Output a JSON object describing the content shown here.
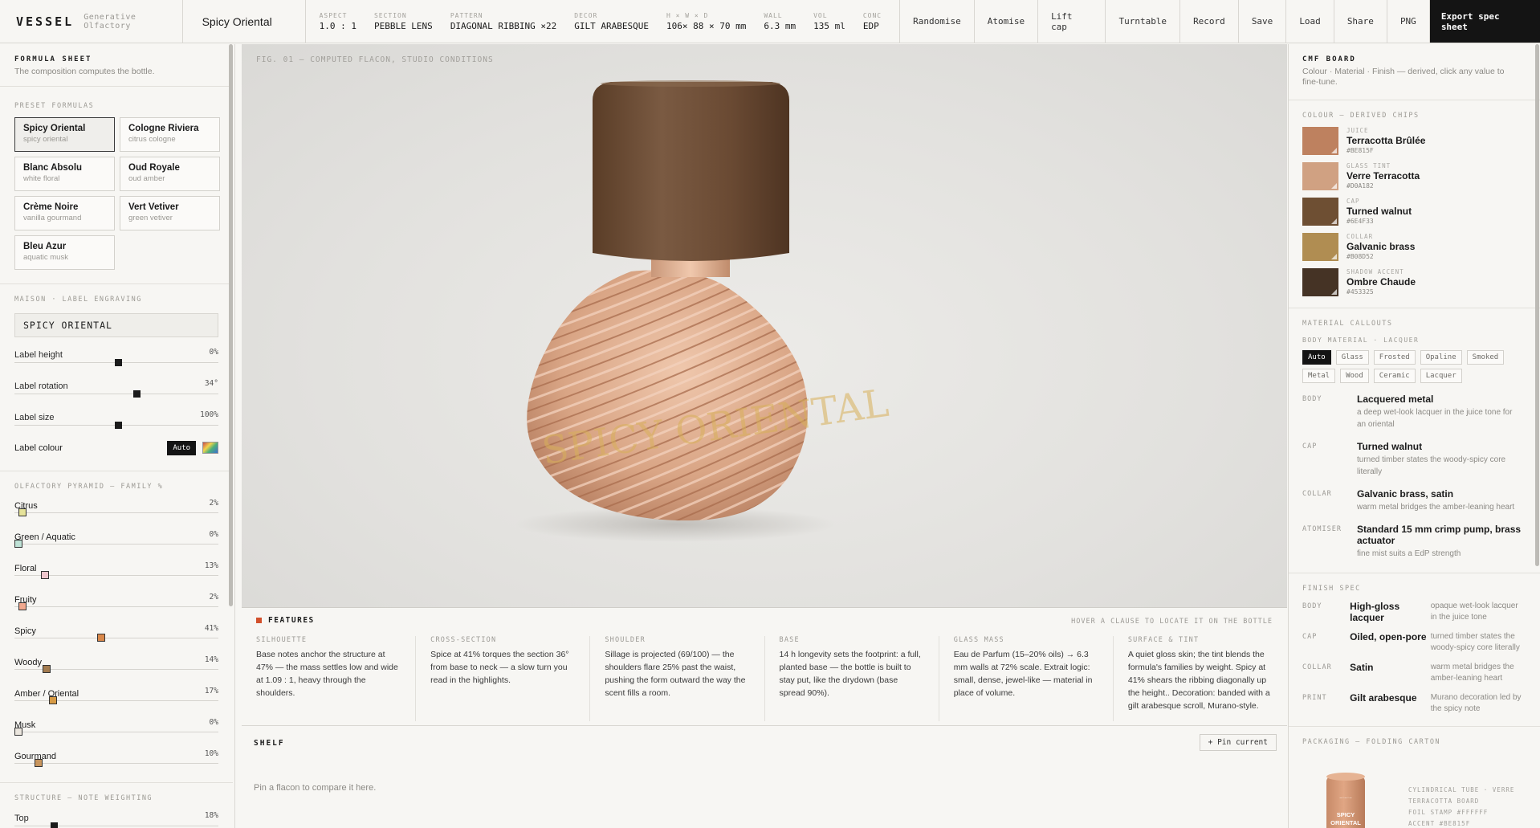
{
  "brand": {
    "logo": "VESSEL",
    "tagline": "Generative Olfactory"
  },
  "formula_name": "Spicy Oriental",
  "specs": [
    {
      "k": "ASPECT",
      "v": "1.0 : 1"
    },
    {
      "k": "SECTION",
      "v": "PEBBLE LENS"
    },
    {
      "k": "PATTERN",
      "v": "DIAGONAL RIBBING ×22"
    },
    {
      "k": "DECOR",
      "v": "GILT ARABESQUE"
    },
    {
      "k": "H × W × D",
      "v": "106× 88 × 70  mm"
    },
    {
      "k": "WALL",
      "v": "6.3  mm"
    },
    {
      "k": "VOL",
      "v": "135 ml"
    },
    {
      "k": "CONC",
      "v": "EDP"
    }
  ],
  "toolbar": {
    "randomise": "Randomise",
    "atomise": "Atomise",
    "lift_cap": "Lift cap",
    "turntable": "Turntable",
    "record": "Record",
    "save": "Save",
    "load": "Load",
    "share": "Share",
    "png": "PNG",
    "export": "Export spec sheet"
  },
  "left": {
    "title": "FORMULA SHEET",
    "subtitle": "The composition computes the bottle.",
    "presets_label": "PRESET FORMULAS",
    "presets": [
      {
        "name": "Spicy Oriental",
        "sub": "spicy oriental",
        "active": true
      },
      {
        "name": "Cologne Riviera",
        "sub": "citrus cologne"
      },
      {
        "name": "Blanc Absolu",
        "sub": "white floral"
      },
      {
        "name": "Oud Royale",
        "sub": "oud amber"
      },
      {
        "name": "Crème Noire",
        "sub": "vanilla gourmand"
      },
      {
        "name": "Vert Vetiver",
        "sub": "green vetiver"
      },
      {
        "name": "Bleu Azur",
        "sub": "aquatic musk"
      }
    ],
    "label_section": "MAISON · LABEL ENGRAVING",
    "label_text": "SPICY ORIENTAL",
    "label_sliders": [
      {
        "name": "Label height",
        "value": "0%",
        "pos": 0.5
      },
      {
        "name": "Label rotation",
        "value": "34°",
        "pos": 0.59
      },
      {
        "name": "Label size",
        "value": "100%",
        "pos": 0.5
      }
    ],
    "label_colour": {
      "name": "Label colour",
      "auto": "Auto"
    },
    "pyramid_label": "OLFACTORY PYRAMID — FAMILY %",
    "pyramid": [
      {
        "name": "Citrus",
        "value": "2%",
        "pos": 0.02,
        "color": "#e6e39a"
      },
      {
        "name": "Green / Aquatic",
        "value": "0%",
        "pos": 0.0,
        "color": "#bfe2d6"
      },
      {
        "name": "Floral",
        "value": "13%",
        "pos": 0.13,
        "color": "#efc6cd"
      },
      {
        "name": "Fruity",
        "value": "2%",
        "pos": 0.02,
        "color": "#f1a98f"
      },
      {
        "name": "Spicy",
        "value": "41%",
        "pos": 0.41,
        "color": "#d9884a"
      },
      {
        "name": "Woody",
        "value": "14%",
        "pos": 0.14,
        "color": "#a37b4f"
      },
      {
        "name": "Amber / Oriental",
        "value": "17%",
        "pos": 0.17,
        "color": "#d69a45"
      },
      {
        "name": "Musk",
        "value": "0%",
        "pos": 0.0,
        "color": "#ebe6de"
      },
      {
        "name": "Gourmand",
        "value": "10%",
        "pos": 0.1,
        "color": "#c8955d"
      }
    ],
    "structure_label": "STRUCTURE — NOTE WEIGHTING",
    "structure": [
      {
        "name": "Top",
        "value": "18%",
        "pos": 0.18
      }
    ]
  },
  "viewport": {
    "fig_label": "FIG. 01 — COMPUTED FLACON, STUDIO CONDITIONS",
    "engrave": "SPICY ORIENTAL"
  },
  "features": {
    "title": "FEATURES",
    "hint": "HOVER A CLAUSE TO LOCATE IT ON THE BOTTLE",
    "cols": [
      {
        "t": "SILHOUETTE",
        "b": "Base notes anchor the structure at 47% — the mass settles low and wide at 1.09 : 1, heavy through the shoulders."
      },
      {
        "t": "CROSS-SECTION",
        "b": "Spice at 41% torques the section 36° from base to neck — a slow turn you read in the highlights."
      },
      {
        "t": "SHOULDER",
        "b": "Sillage is projected (69/100) — the shoulders flare 25% past the waist, pushing the form outward the way the scent fills a room."
      },
      {
        "t": "BASE",
        "b": "14 h longevity sets the footprint: a full, planted base — the bottle is built to stay put, like the drydown (base spread 90%)."
      },
      {
        "t": "GLASS MASS",
        "b": "Eau de Parfum (15–20% oils) → 6.3 mm walls at 72% scale. Extrait logic: small, dense, jewel-like — material in place of volume."
      },
      {
        "t": "SURFACE & TINT",
        "b": "A quiet gloss skin; the tint blends the formula's families by weight. Spicy at 41% shears the ribbing diagonally up the height.. Decoration: banded with a gilt arabesque scroll, Murano-style."
      }
    ]
  },
  "shelf": {
    "title": "SHELF",
    "pin": "+ Pin current",
    "empty": "Pin a flacon to compare it here."
  },
  "right": {
    "title": "CMF BOARD",
    "subtitle": "Colour · Material · Finish — derived, click any value to fine-tune.",
    "colour_label": "COLOUR — DERIVED CHIPS",
    "chips": [
      {
        "k": "JUICE",
        "n": "Terracotta Brûlée",
        "h": "#BE815F",
        "color": "#BE815F"
      },
      {
        "k": "GLASS TINT",
        "n": "Verre Terracotta",
        "h": "#D0A182",
        "color": "#D0A182"
      },
      {
        "k": "CAP",
        "n": "Turned walnut",
        "h": "#6E4F33",
        "color": "#6E4F33"
      },
      {
        "k": "COLLAR",
        "n": "Galvanic brass",
        "h": "#B08D52",
        "color": "#B08D52"
      },
      {
        "k": "SHADOW ACCENT",
        "n": "Ombre Chaude",
        "h": "#453325",
        "color": "#453325"
      }
    ],
    "material_label": "MATERIAL CALLOUTS",
    "body_material_label": "BODY MATERIAL · LACQUER",
    "materials": [
      "Auto",
      "Glass",
      "Frosted",
      "Opaline",
      "Smoked",
      "Metal",
      "Wood",
      "Ceramic",
      "Lacquer"
    ],
    "callouts": [
      {
        "k": "BODY",
        "n": "Lacquered metal",
        "d": "a deep wet-look lacquer in the juice tone for an oriental"
      },
      {
        "k": "CAP",
        "n": "Turned walnut",
        "d": "turned timber states the woody-spicy core literally"
      },
      {
        "k": "COLLAR",
        "n": "Galvanic brass, satin",
        "d": "warm metal bridges the amber-leaning heart"
      },
      {
        "k": "ATOMISER",
        "n": "Standard 15 mm crimp pump, brass actuator",
        "d": "fine mist suits a EdP strength"
      }
    ],
    "finish_label": "FINISH SPEC",
    "finish": [
      {
        "k": "BODY",
        "n": "High-gloss lacquer",
        "d": "opaque wet-look lacquer in the juice tone"
      },
      {
        "k": "CAP",
        "n": "Oiled, open-pore",
        "d": "turned timber states the woody-spicy core literally"
      },
      {
        "k": "COLLAR",
        "n": "Satin",
        "d": "warm metal bridges the amber-leaning heart"
      },
      {
        "k": "PRINT",
        "n": "Gilt arabesque",
        "d": "Murano decoration led by the spicy note"
      }
    ],
    "packaging_label": "PACKAGING — FOLDING CARTON",
    "carton": {
      "name_line1": "SPICY",
      "name_line2": "ORIENTAL",
      "maison": "—·—·—",
      "meta": [
        "CYLINDRICAL TUBE · VERRE",
        "TERRACOTTA BOARD",
        "FOIL STAMP #FFFFFF",
        "ACCENT #BE815F"
      ]
    }
  }
}
